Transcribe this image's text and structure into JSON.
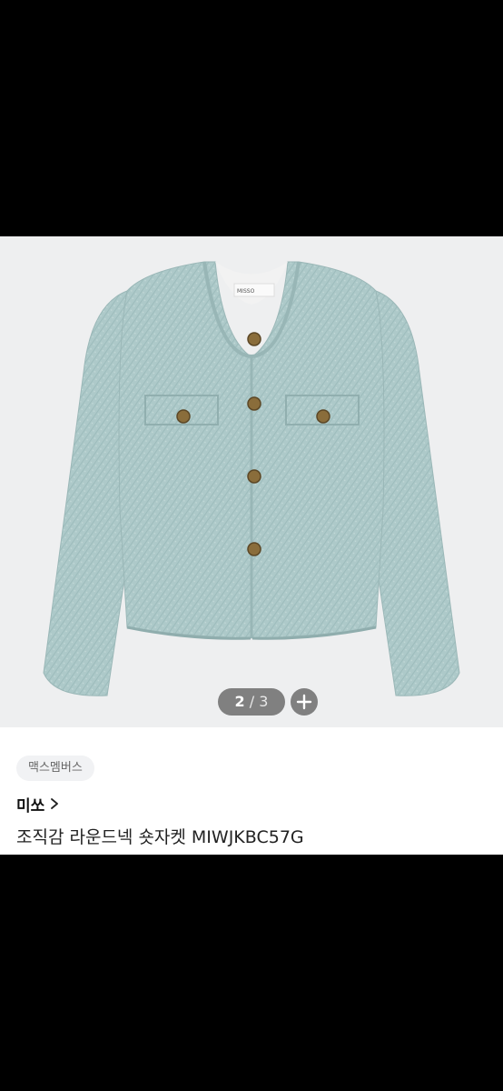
{
  "gallery": {
    "image_alt": "sky blue tweed round-neck short jacket",
    "label_text": "MISSO",
    "pager": {
      "current": "2",
      "separator": "/",
      "total": "3"
    },
    "zoom_icon": "plus-icon"
  },
  "product": {
    "tag": "맥스멤버스",
    "brand": "미쏘",
    "brand_chevron_icon": "chevron-right-icon",
    "title": "조직감 라운드넥 숏자켓 MIWJKBC57G"
  },
  "colors": {
    "jacket": "#a9c6c6",
    "background": "#eeeff0",
    "button_gold": "#8a6d3b"
  }
}
